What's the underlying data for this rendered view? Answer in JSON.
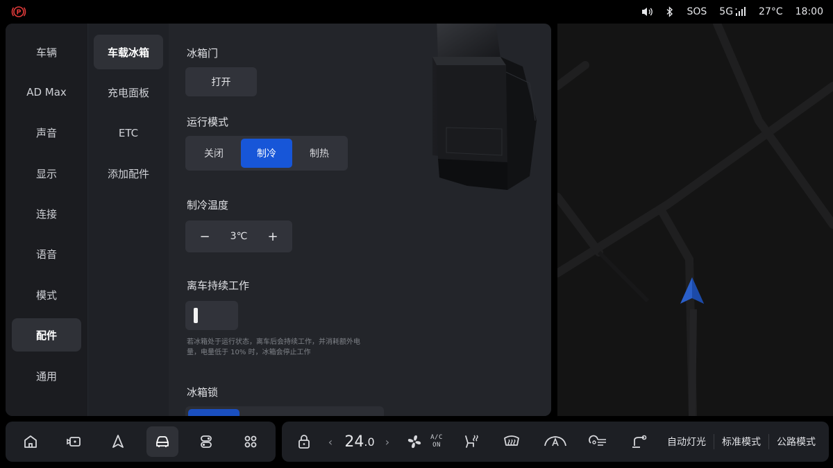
{
  "status": {
    "park_icon": "parking-brake-icon",
    "volume_icon": "volume-icon",
    "bluetooth_icon": "bluetooth-icon",
    "sos": "SOS",
    "network": "5G",
    "temperature": "27°C",
    "time": "18:00",
    "colors": {
      "park_red": "#e03a3a"
    }
  },
  "nav": {
    "items": [
      {
        "label": "车辆"
      },
      {
        "label": "AD Max"
      },
      {
        "label": "声音"
      },
      {
        "label": "显示"
      },
      {
        "label": "连接"
      },
      {
        "label": "语音"
      },
      {
        "label": "模式"
      },
      {
        "label": "配件"
      },
      {
        "label": "通用"
      }
    ],
    "active": "配件"
  },
  "subnav": {
    "items": [
      {
        "label": "车载冰箱"
      },
      {
        "label": "充电面板"
      },
      {
        "label": "ETC"
      },
      {
        "label": "添加配件"
      }
    ],
    "active": "车载冰箱"
  },
  "fridge": {
    "door_label": "冰箱门",
    "open_button": "打开",
    "mode_label": "运行模式",
    "modes": [
      "关闭",
      "制冷",
      "制热"
    ],
    "selected_mode": "制冷",
    "cool_temp_label": "制冷温度",
    "minus": "−",
    "plus": "+",
    "temp_value": "3℃",
    "keep_working_label": "离车持续工作",
    "keep_working_on": false,
    "hint_line1": "若冰箱处于运行状态，离车后会持续工作，并消耗额外电",
    "hint_line2": "量，电量低于 10% 时，冰箱会停止工作",
    "lock_label": "冰箱锁",
    "accent": "#1756d8"
  },
  "dock": {
    "left_icons": [
      "home-icon",
      "camera-icon",
      "navigation-icon",
      "car-icon",
      "toggles-icon",
      "apps-grid-icon"
    ],
    "active_icon": "car-icon",
    "lock_icon": "lock-icon",
    "temp_main": "24",
    "temp_decimal": ".0",
    "chevron_left": "‹",
    "chevron_right": "›",
    "fan_icon": "fan-icon",
    "ac_line1": "A/C",
    "ac_line2": "ON",
    "right_icons": [
      "seat-heat-icon",
      "defrost-rear-icon",
      "defrost-front-auto-icon",
      "headlight-icon",
      "wiper-icon"
    ],
    "auto_light": "自动灯光",
    "standard_mode": "标准模式",
    "road_mode": "公路模式"
  }
}
